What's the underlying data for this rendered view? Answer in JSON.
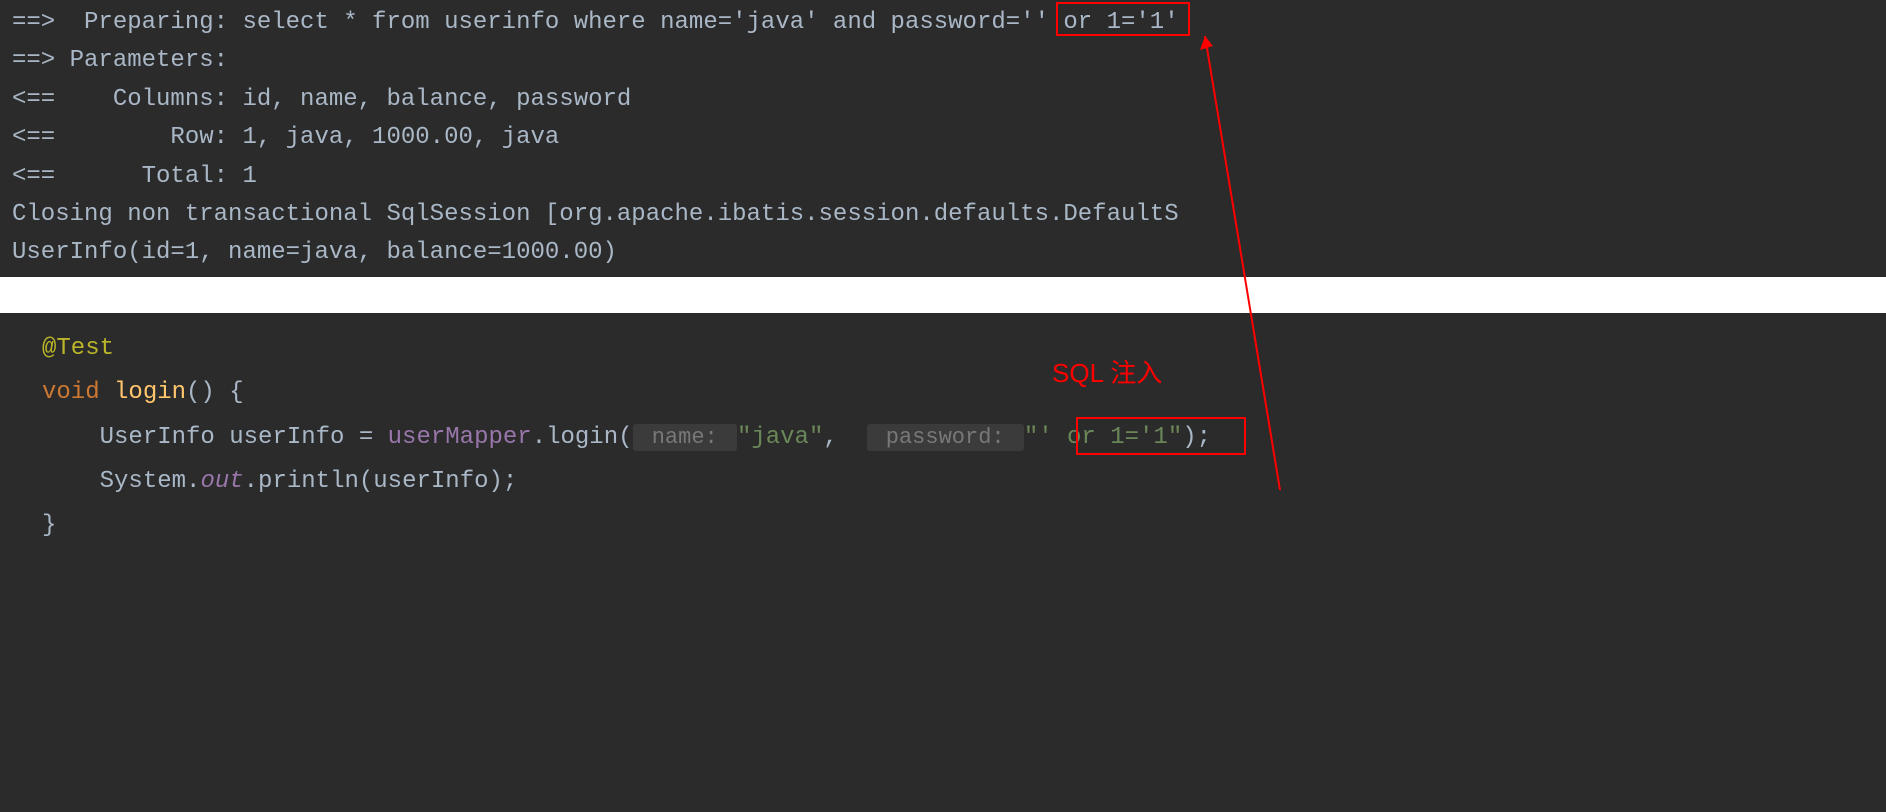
{
  "console": {
    "line1": "==>  Preparing: select * from userinfo where name='java' and password='' or 1='1'",
    "line2": "==> Parameters:",
    "line3": "<==    Columns: id, name, balance, password",
    "line4": "<==        Row: 1, java, 1000.00, java",
    "line5": "<==      Total: 1",
    "line6": "Closing non transactional SqlSession [org.apache.ibatis.session.defaults.DefaultS",
    "line7": "UserInfo(id=1, name=java, balance=1000.00)"
  },
  "code": {
    "annotation": "@Test",
    "keyword_void": "void",
    "method_name": "login",
    "paren_open": "() {",
    "userinfo_type": "UserInfo userInfo = ",
    "usermapper": "userMapper",
    "login_call": ".login(",
    "hint_name": " name: ",
    "str_java": "\"java\"",
    "comma": ",  ",
    "hint_password": " password: ",
    "str_injection": "\"' or 1='1\"",
    "close_call": ");",
    "system": "System.",
    "out_field": "out",
    "println": ".println(userInfo);",
    "brace_close": "}"
  },
  "annotation_label": "SQL 注入"
}
